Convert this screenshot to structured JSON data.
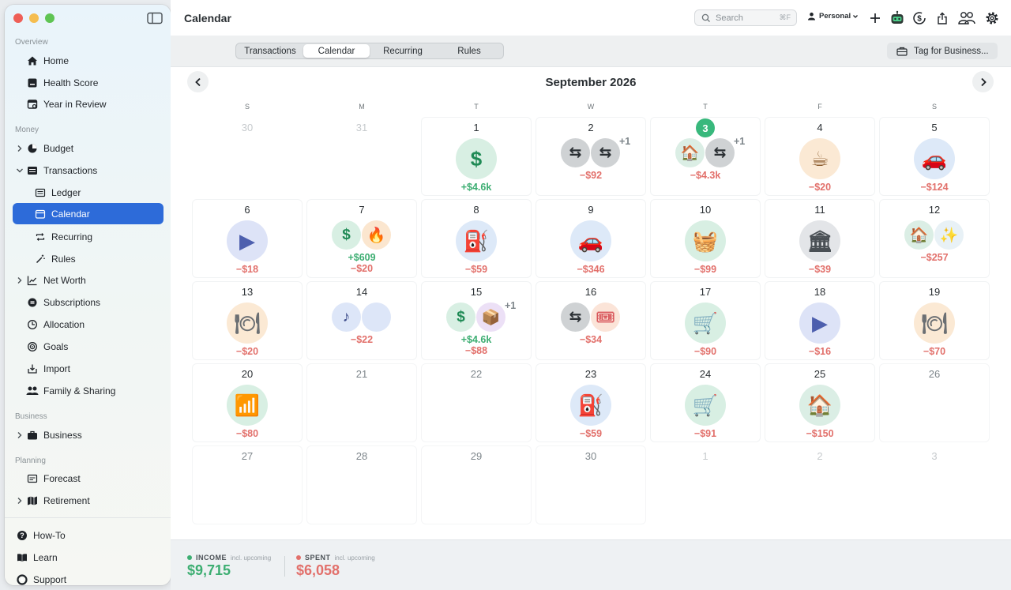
{
  "sidebar": {
    "sections": {
      "overview": "Overview",
      "money": "Money",
      "business": "Business",
      "planning": "Planning"
    },
    "items": {
      "home": "Home",
      "health_score": "Health Score",
      "year_in_review": "Year in Review",
      "budget": "Budget",
      "transactions": "Transactions",
      "ledger": "Ledger",
      "calendar": "Calendar",
      "recurring": "Recurring",
      "rules": "Rules",
      "net_worth": "Net Worth",
      "subscriptions": "Subscriptions",
      "allocation": "Allocation",
      "goals": "Goals",
      "import": "Import",
      "family_sharing": "Family & Sharing",
      "business": "Business",
      "forecast": "Forecast",
      "retirement": "Retirement"
    },
    "footer": {
      "how_to": "How-To",
      "learn": "Learn",
      "support": "Support"
    }
  },
  "header": {
    "title": "Calendar",
    "search_placeholder": "Search",
    "search_shortcut": "⌘F",
    "profile": "Personal"
  },
  "tabs": [
    "Transactions",
    "Calendar",
    "Recurring",
    "Rules"
  ],
  "active_tab": "Calendar",
  "tag_button": "Tag for Business...",
  "calendar": {
    "month": "September 2026",
    "weekdays": [
      "S",
      "M",
      "T",
      "W",
      "T",
      "F",
      "S"
    ],
    "days": [
      {
        "d": "30",
        "muted": true
      },
      {
        "d": "31",
        "muted": true
      },
      {
        "d": "1",
        "icons": [
          {
            "n": "dollar-icon",
            "bg": "#d8efe3",
            "g": "$",
            "c": "#1f8a55"
          }
        ],
        "lines": [
          {
            "t": "+$4.6k",
            "k": "pos"
          }
        ]
      },
      {
        "d": "2",
        "icons": [
          {
            "n": "transfer-icon",
            "bg": "#cfd2d4",
            "g": "⇆",
            "c": "#2a2f33"
          },
          {
            "n": "transfer-icon",
            "bg": "#cfd2d4",
            "g": "⇆",
            "c": "#2a2f33"
          }
        ],
        "more": "+1",
        "lines": [
          {
            "t": "−$92",
            "k": "neg"
          }
        ]
      },
      {
        "d": "3",
        "today": true,
        "icons": [
          {
            "n": "home-icon",
            "bg": "#dbeee5",
            "g": "🏠",
            "c": "#2a2f33"
          },
          {
            "n": "transfer-icon",
            "bg": "#cfd2d4",
            "g": "⇆",
            "c": "#2a2f33"
          }
        ],
        "more": "+1",
        "lines": [
          {
            "t": "−$4.3k",
            "k": "neg"
          }
        ]
      },
      {
        "d": "4",
        "icons": [
          {
            "n": "coffee-icon",
            "bg": "#fbe9d4",
            "g": "☕",
            "c": "#8a5a2b"
          }
        ],
        "lines": [
          {
            "t": "−$20",
            "k": "neg"
          }
        ]
      },
      {
        "d": "5",
        "icons": [
          {
            "n": "car-icon",
            "bg": "#dde9f8",
            "g": "🚗",
            "c": "#d23b3b"
          }
        ],
        "lines": [
          {
            "t": "−$124",
            "k": "neg"
          }
        ]
      },
      {
        "d": "6",
        "icons": [
          {
            "n": "video-play-icon",
            "bg": "#dde3f7",
            "g": "▶",
            "c": "#4d5fae"
          }
        ],
        "lines": [
          {
            "t": "−$18",
            "k": "neg"
          }
        ]
      },
      {
        "d": "7",
        "icons": [
          {
            "n": "dollar-icon",
            "bg": "#d8efe3",
            "g": "$",
            "c": "#1f8a55"
          },
          {
            "n": "fire-icon",
            "bg": "#fbe6cf",
            "g": "🔥",
            "c": "#c66a20"
          }
        ],
        "lines": [
          {
            "t": "+$609",
            "k": "pos"
          },
          {
            "t": "−$20",
            "k": "neg"
          }
        ]
      },
      {
        "d": "8",
        "icons": [
          {
            "n": "fuel-pump-icon",
            "bg": "#dde9f8",
            "g": "⛽",
            "c": "#3b6ab0"
          }
        ],
        "lines": [
          {
            "t": "−$59",
            "k": "neg"
          }
        ]
      },
      {
        "d": "9",
        "icons": [
          {
            "n": "car-icon",
            "bg": "#dde9f8",
            "g": "🚗",
            "c": "#d23b3b"
          }
        ],
        "lines": [
          {
            "t": "−$346",
            "k": "neg"
          }
        ]
      },
      {
        "d": "10",
        "icons": [
          {
            "n": "basket-icon",
            "bg": "#d8efe3",
            "g": "🧺",
            "c": "#1f8a55"
          }
        ],
        "lines": [
          {
            "t": "−$99",
            "k": "neg"
          }
        ]
      },
      {
        "d": "11",
        "icons": [
          {
            "n": "bank-icon",
            "bg": "#e3e5e8",
            "g": "🏛",
            "c": "#4a5055"
          }
        ],
        "lines": [
          {
            "t": "−$39",
            "k": "neg"
          }
        ]
      },
      {
        "d": "12",
        "icons": [
          {
            "n": "home-icon",
            "bg": "#dbeee5",
            "g": "🏠",
            "c": "#2a2f33"
          },
          {
            "n": "sparkles-icon",
            "bg": "#e8f1f6",
            "g": "✨",
            "c": "#e0b020"
          }
        ],
        "lines": [
          {
            "t": "−$257",
            "k": "neg"
          }
        ]
      },
      {
        "d": "13",
        "icons": [
          {
            "n": "dining-icon",
            "bg": "#fbe9d4",
            "g": "🍽",
            "c": "#6b6f73"
          }
        ],
        "lines": [
          {
            "t": "−$20",
            "k": "neg"
          }
        ]
      },
      {
        "d": "14",
        "icons": [
          {
            "n": "music-note-icon",
            "bg": "#dde6f8",
            "g": "♪",
            "c": "#3c4b8a"
          },
          {
            "n": "apple-icon",
            "bg": "#dde6f8",
            "g": "",
            "c": "#3c4b8a"
          }
        ],
        "lines": [
          {
            "t": "−$22",
            "k": "neg"
          }
        ]
      },
      {
        "d": "15",
        "icons": [
          {
            "n": "dollar-icon",
            "bg": "#d8efe3",
            "g": "$",
            "c": "#1f8a55"
          },
          {
            "n": "package-icon",
            "bg": "#ece0f6",
            "g": "📦",
            "c": "#8a4fc0"
          }
        ],
        "more": "+1",
        "lines": [
          {
            "t": "+$4.6k",
            "k": "pos"
          },
          {
            "t": "−$88",
            "k": "neg"
          }
        ]
      },
      {
        "d": "16",
        "icons": [
          {
            "n": "transfer-icon",
            "bg": "#cfd2d4",
            "g": "⇆",
            "c": "#2a2f33"
          },
          {
            "n": "ticket-icon",
            "bg": "#fbe4d8",
            "g": "🎟",
            "c": "#d8555a"
          }
        ],
        "lines": [
          {
            "t": "−$34",
            "k": "neg"
          }
        ]
      },
      {
        "d": "17",
        "icons": [
          {
            "n": "shopping-cart-icon",
            "bg": "#d8efe3",
            "g": "🛒",
            "c": "#2a2f33"
          }
        ],
        "lines": [
          {
            "t": "−$90",
            "k": "neg"
          }
        ]
      },
      {
        "d": "18",
        "icons": [
          {
            "n": "video-play-icon",
            "bg": "#dde3f7",
            "g": "▶",
            "c": "#4d5fae"
          }
        ],
        "lines": [
          {
            "t": "−$16",
            "k": "neg"
          }
        ]
      },
      {
        "d": "19",
        "icons": [
          {
            "n": "dining-icon",
            "bg": "#fbe9d4",
            "g": "🍽",
            "c": "#6b6f73"
          }
        ],
        "lines": [
          {
            "t": "−$70",
            "k": "neg"
          }
        ]
      },
      {
        "d": "20",
        "icons": [
          {
            "n": "wifi-icon",
            "bg": "#d8efe3",
            "g": "📶",
            "c": "#1f8a55"
          }
        ],
        "lines": [
          {
            "t": "−$80",
            "k": "neg"
          }
        ]
      },
      {
        "d": "21",
        "gray": true
      },
      {
        "d": "22",
        "gray": true
      },
      {
        "d": "23",
        "icons": [
          {
            "n": "fuel-pump-icon",
            "bg": "#dde9f8",
            "g": "⛽",
            "c": "#3b6ab0"
          }
        ],
        "lines": [
          {
            "t": "−$59",
            "k": "neg"
          }
        ]
      },
      {
        "d": "24",
        "icons": [
          {
            "n": "shopping-cart-icon",
            "bg": "#d8efe3",
            "g": "🛒",
            "c": "#1f8a55"
          }
        ],
        "lines": [
          {
            "t": "−$91",
            "k": "neg"
          }
        ]
      },
      {
        "d": "25",
        "icons": [
          {
            "n": "home-icon",
            "bg": "#dbeee5",
            "g": "🏠",
            "c": "#2a2f33"
          }
        ],
        "lines": [
          {
            "t": "−$150",
            "k": "neg"
          }
        ]
      },
      {
        "d": "26",
        "gray": true
      },
      {
        "d": "27",
        "gray": true
      },
      {
        "d": "28",
        "gray": true
      },
      {
        "d": "29",
        "gray": true
      },
      {
        "d": "30",
        "gray": true
      },
      {
        "d": "1",
        "muted": true
      },
      {
        "d": "2",
        "muted": true
      },
      {
        "d": "3",
        "muted": true
      }
    ]
  },
  "summary": {
    "income_label": "INCOME",
    "income_sub": "incl. upcoming",
    "income_value": "$9,715",
    "spent_label": "SPENT",
    "spent_sub": "incl. upcoming",
    "spent_value": "$6,058"
  },
  "colors": {
    "accent": "#2d6bd9",
    "positive": "#3dae72",
    "negative": "#e2706b",
    "today": "#38b87c"
  }
}
